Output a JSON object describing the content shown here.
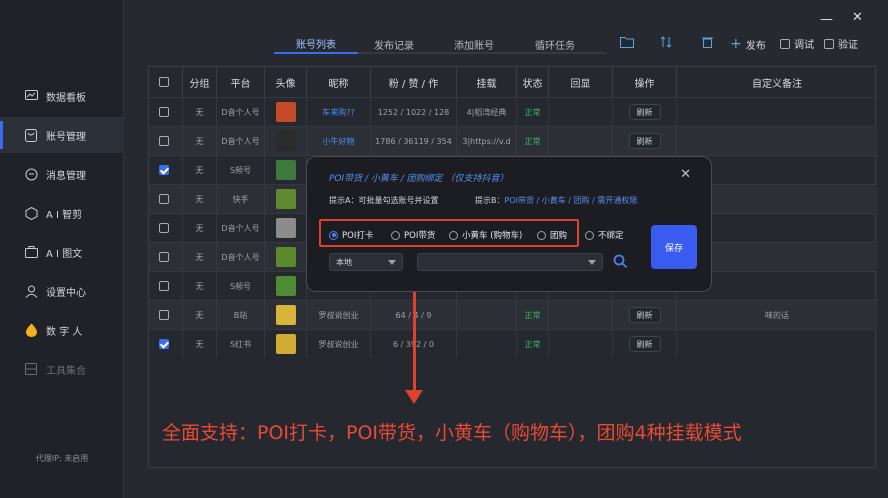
{
  "sidebar": {
    "items": [
      {
        "label": "数据看板",
        "icon": "dashboard-icon"
      },
      {
        "label": "账号管理",
        "icon": "account-icon"
      },
      {
        "label": "消息管理",
        "icon": "message-icon"
      },
      {
        "label": "A I 智剪",
        "icon": "ai-cut-icon"
      },
      {
        "label": "A I 图文",
        "icon": "ai-image-text-icon"
      },
      {
        "label": "设置中心",
        "icon": "settings-icon"
      },
      {
        "label": "数 字 人",
        "icon": "digital-human-icon"
      },
      {
        "label": "工具集合",
        "icon": "tools-icon"
      }
    ],
    "proxy": "代理IP: 未启用"
  },
  "tabs": [
    "账号列表",
    "发布记录",
    "添加账号",
    "循环任务"
  ],
  "toolbar": {
    "publish": "发布",
    "debug": "调试",
    "verify": "验证"
  },
  "table": {
    "headers": [
      "分组",
      "平台",
      "头像",
      "昵称",
      "粉 / 赞 / 作",
      "挂载",
      "状态",
      "回显",
      "操作",
      "自定义备注"
    ],
    "rows": [
      {
        "checked": false,
        "group": "无",
        "platform": "D音个人号",
        "nick": "车来购??",
        "stats": "1252 / 1022 / 128",
        "mount": "4|稻湾经典",
        "status": "正常",
        "action": "刷新",
        "note": ""
      },
      {
        "checked": false,
        "group": "无",
        "platform": "D音个人号",
        "nick": "小牛好物",
        "stats": "1786 / 36119 / 354",
        "mount": "3|https://v.d",
        "status": "正常",
        "action": "刷新",
        "note": ""
      },
      {
        "checked": true,
        "group": "无",
        "platform": "S频号",
        "nick": "",
        "stats": "",
        "mount": "",
        "status": "",
        "action": "",
        "note": ""
      },
      {
        "checked": false,
        "group": "无",
        "platform": "快手",
        "nick": "",
        "stats": "",
        "mount": "",
        "status": "",
        "action": "",
        "note": ""
      },
      {
        "checked": false,
        "group": "无",
        "platform": "D音个人号",
        "nick": "",
        "stats": "",
        "mount": "",
        "status": "",
        "action": "",
        "note": ""
      },
      {
        "checked": false,
        "group": "无",
        "platform": "D音个人号",
        "nick": "",
        "stats": "",
        "mount": "",
        "status": "",
        "action": "",
        "note": ""
      },
      {
        "checked": false,
        "group": "无",
        "platform": "S频号",
        "nick": "",
        "stats": "",
        "mount": "",
        "status": "",
        "action": "",
        "note": ""
      },
      {
        "checked": false,
        "group": "无",
        "platform": "B站",
        "nick": "罗叔说创业",
        "stats": "64 / 4 / 9",
        "mount": "",
        "status": "正常",
        "action": "刷新",
        "note": "味的话"
      },
      {
        "checked": true,
        "group": "无",
        "platform": "S红书",
        "nick": "罗叔说创业",
        "stats": "6 / 392 / 0",
        "mount": "",
        "status": "正常",
        "action": "刷新",
        "note": ""
      }
    ]
  },
  "dialog": {
    "title": "POI带货 / 小黄车 / 团购绑定  （仅支持抖音）",
    "hint_a": "提示A：可批量勾选账号并设置",
    "hint_b_prefix": "提示B：",
    "hint_b": "POI带货 / 小黄车 / 团购 / 需开通权限",
    "options": [
      "POI打卡",
      "POI带货",
      "小黄车 (购物车)",
      "团购",
      "不绑定"
    ],
    "selected": "POI打卡",
    "location": "本地",
    "save": "保存"
  },
  "caption": "全面支持：POI打卡，POI带货，小黄车（购物车），团购4种挂载模式"
}
